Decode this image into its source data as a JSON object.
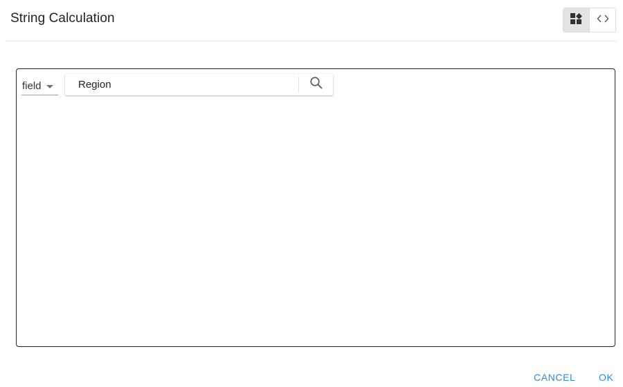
{
  "dialog": {
    "title": "String Calculation"
  },
  "view_toggle": {
    "visual_icon": "visual-editor-icon",
    "code_icon": "code-brackets-icon",
    "active": "visual"
  },
  "editor": {
    "field_select": {
      "selected": "field",
      "caret_icon": "caret-down-icon"
    },
    "search": {
      "value": "Region",
      "icon": "search-icon"
    }
  },
  "footer": {
    "cancel_label": "CANCEL",
    "ok_label": "OK",
    "accent_color": "#2e8ad6"
  }
}
